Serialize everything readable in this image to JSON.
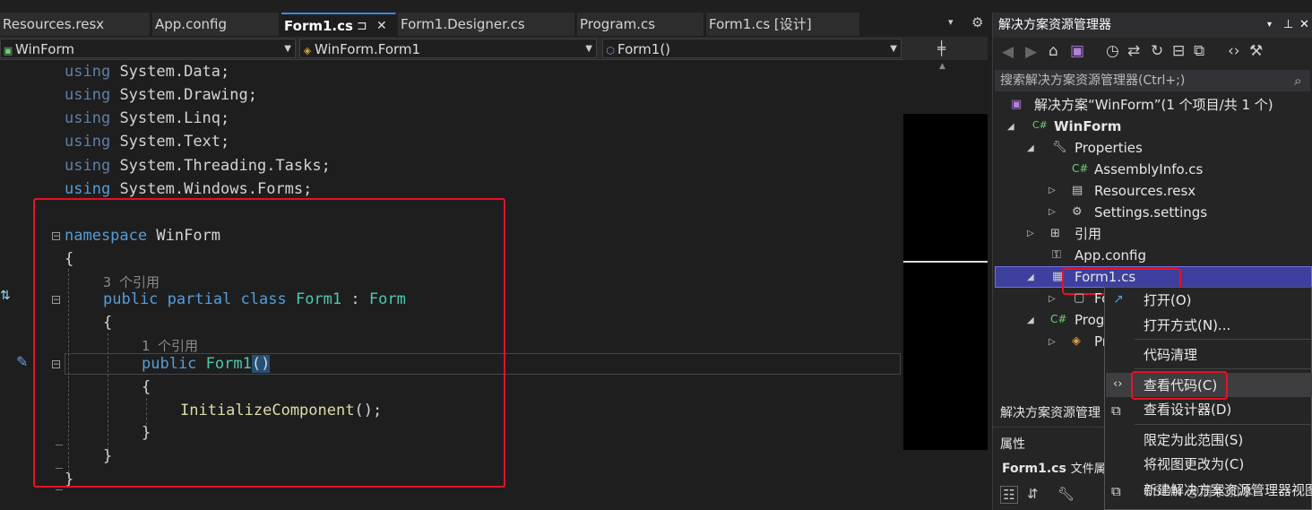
{
  "tabs": [
    {
      "label": "Resources.resx"
    },
    {
      "label": "App.config"
    },
    {
      "label": "Form1.cs",
      "active": true
    },
    {
      "label": "Form1.Designer.cs"
    },
    {
      "label": "Program.cs"
    },
    {
      "label": "Form1.cs [设计]"
    }
  ],
  "tab_pin": "⊐",
  "tab_close": "✕",
  "tab_overflow": "▾",
  "tab_settings": "⚙",
  "navbar": {
    "project": "WinForm",
    "klass": "WinForm.Form1",
    "member": "Form1()"
  },
  "code": {
    "using_kw": "using",
    "usings": [
      "System.Data;",
      "System.Drawing;",
      "System.Linq;",
      "System.Text;",
      "System.Threading.Tasks;",
      "System.Windows.Forms;"
    ],
    "namespace_kw": "namespace",
    "namespace_name": "WinForm",
    "open_brace": "{",
    "close_brace": "}",
    "class_refs": "3 个引用",
    "class_mods": "public partial class",
    "class_name": "Form1",
    "class_colon": ":",
    "class_base": "Form",
    "ctor_refs": "1 个引用",
    "ctor_kw": "public",
    "ctor_name": "Form1",
    "ctor_parens": "()",
    "call_name": "InitializeComponent",
    "call_tail": "();"
  },
  "solution_explorer": {
    "title": "解决方案资源管理器",
    "search_placeholder": "搜索解决方案资源管理器(Ctrl+;)",
    "items": [
      {
        "label": "解决方案“WinForm”(1 个项目/共 1 个)"
      },
      {
        "label": "WinForm"
      },
      {
        "label": "Properties"
      },
      {
        "label": "AssemblyInfo.cs"
      },
      {
        "label": "Resources.resx"
      },
      {
        "label": "Settings.settings"
      },
      {
        "label": "引用"
      },
      {
        "label": "App.config"
      },
      {
        "label": "Form1.cs"
      },
      {
        "label": "Fo"
      },
      {
        "label": "Prog"
      },
      {
        "label": "Pr"
      }
    ],
    "bottom_tab": "解决方案资源管理",
    "props_title": "属性",
    "props_file": "Form1.cs",
    "props_file_suffix": "文件属"
  },
  "context_menu": {
    "items": [
      {
        "label": "打开(O)"
      },
      {
        "label": "打开方式(N)..."
      },
      {
        "label": "代码清理"
      },
      {
        "label": "查看代码(C)"
      },
      {
        "label": "查看设计器(D)"
      },
      {
        "label": "限定为此范围(S)"
      },
      {
        "label": "将视图更改为(C)"
      },
      {
        "label": "新建解决方案资源管理器视图"
      }
    ]
  },
  "watermark": "CSDN @清水加冰",
  "colors": {
    "accent": "#3c88d8",
    "highlight": "#e81123",
    "keyword": "#569cd6",
    "type": "#4ec9b0",
    "method": "#dcdcaa"
  }
}
